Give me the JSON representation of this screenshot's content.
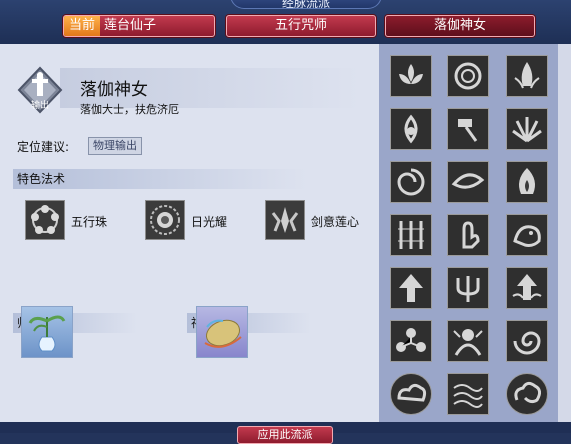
{
  "header": {
    "title": "经脉流派",
    "tabs": [
      {
        "badge": "当前",
        "label": "莲台仙子",
        "active": false
      },
      {
        "label": "五行咒师",
        "active": false
      },
      {
        "label": "落伽神女",
        "active": true
      }
    ]
  },
  "profile": {
    "emblem_label": "输出",
    "name": "落伽神女",
    "tagline": "落伽大士，扶危济厄",
    "role_label": "定位建议:",
    "role_value": "物理输出"
  },
  "spells": {
    "title": "特色法术",
    "items": [
      {
        "label": "五行珠",
        "icon": "five-beads-icon"
      },
      {
        "label": "日光耀",
        "icon": "sun-radiance-icon"
      },
      {
        "label": "剑意莲心",
        "icon": "sword-lotus-icon"
      }
    ]
  },
  "treasure": {
    "title": "师门法宝",
    "icon": "jade-vase-icon"
  },
  "artifact": {
    "title": "神器",
    "icon": "golden-egg-icon"
  },
  "skill_grid": [
    "lotus-icon",
    "spiral-icon",
    "flame-lotus-icon",
    "lotus-bud-icon",
    "hammer-icon",
    "leaf-fan-icon",
    "swirl-icon",
    "eye-icon",
    "fire-icon",
    "bamboo-icon",
    "hand-gesture-icon",
    "beast-icon",
    "arrow-up-icon",
    "trident-icon",
    "arrow-lotus-icon",
    "branch-icon",
    "goddess-icon",
    "vortex-icon",
    "cloud-icon",
    "wave-icon",
    "cloud-curl-icon"
  ],
  "bottom_button": "应用此流派",
  "colors": {
    "tab_red": "#a82a3c",
    "current_orange": "#f08a24",
    "header_blue": "#23345b"
  }
}
